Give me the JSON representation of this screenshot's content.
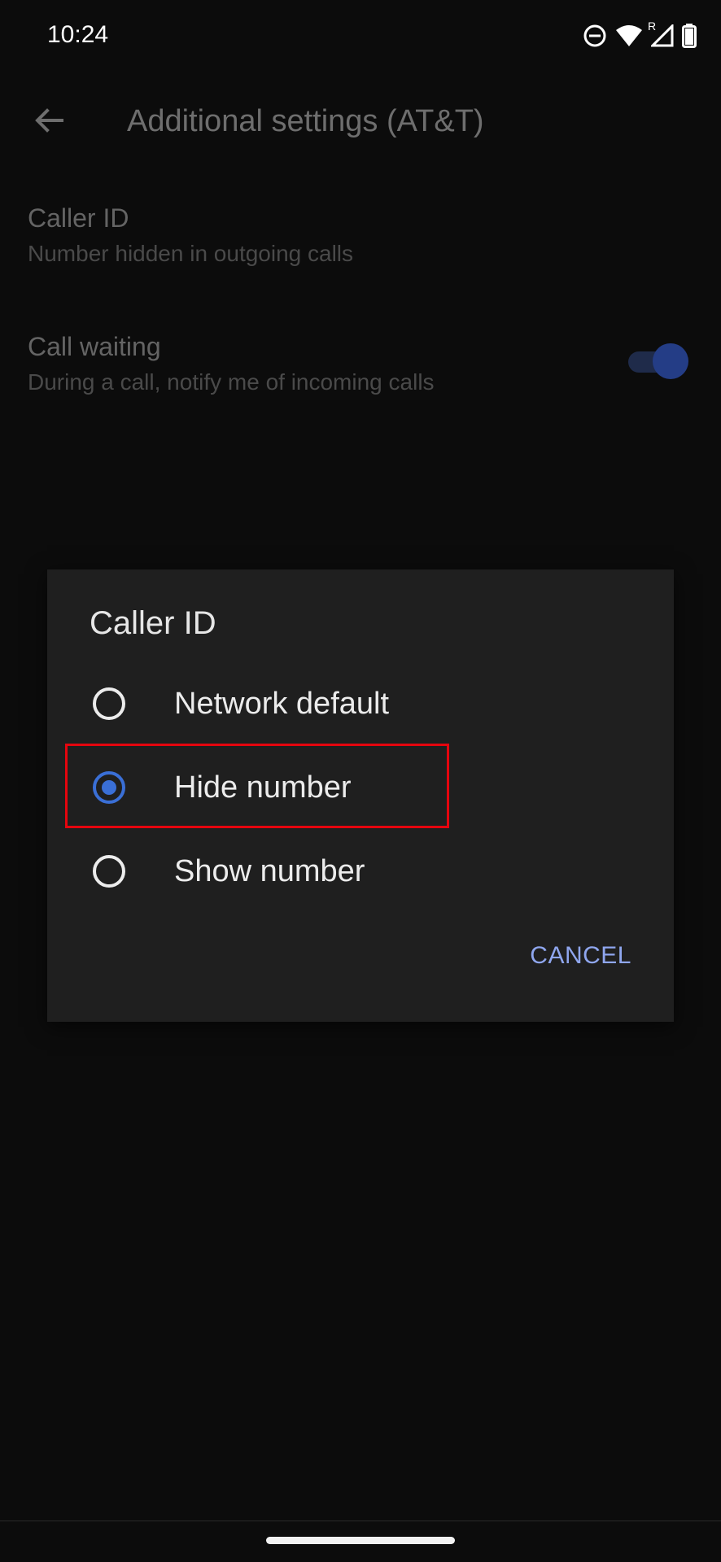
{
  "status_bar": {
    "time": "10:24",
    "icons": [
      "do-not-disturb-icon",
      "wifi-icon",
      "roaming-indicator",
      "cell-signal-icon",
      "battery-icon"
    ],
    "roaming_label": "R"
  },
  "app_bar": {
    "back_icon": "arrow-back-icon",
    "title": "Additional settings (AT&T)"
  },
  "settings": [
    {
      "title": "Caller ID",
      "summary": "Number hidden in outgoing calls"
    },
    {
      "title": "Call waiting",
      "summary": "During a call, notify me of incoming calls",
      "toggle_on": true
    }
  ],
  "dialog": {
    "title": "Caller ID",
    "options": [
      {
        "label": "Network default",
        "selected": false
      },
      {
        "label": "Hide number",
        "selected": true
      },
      {
        "label": "Show number",
        "selected": false
      }
    ],
    "cancel_label": "CANCEL"
  },
  "colors": {
    "background": "#0c0c0c",
    "dialog_background": "#1f1f1f",
    "accent": "#3a6fd6",
    "cancel_text": "#8fa6ee",
    "highlight": "#e5050e"
  }
}
